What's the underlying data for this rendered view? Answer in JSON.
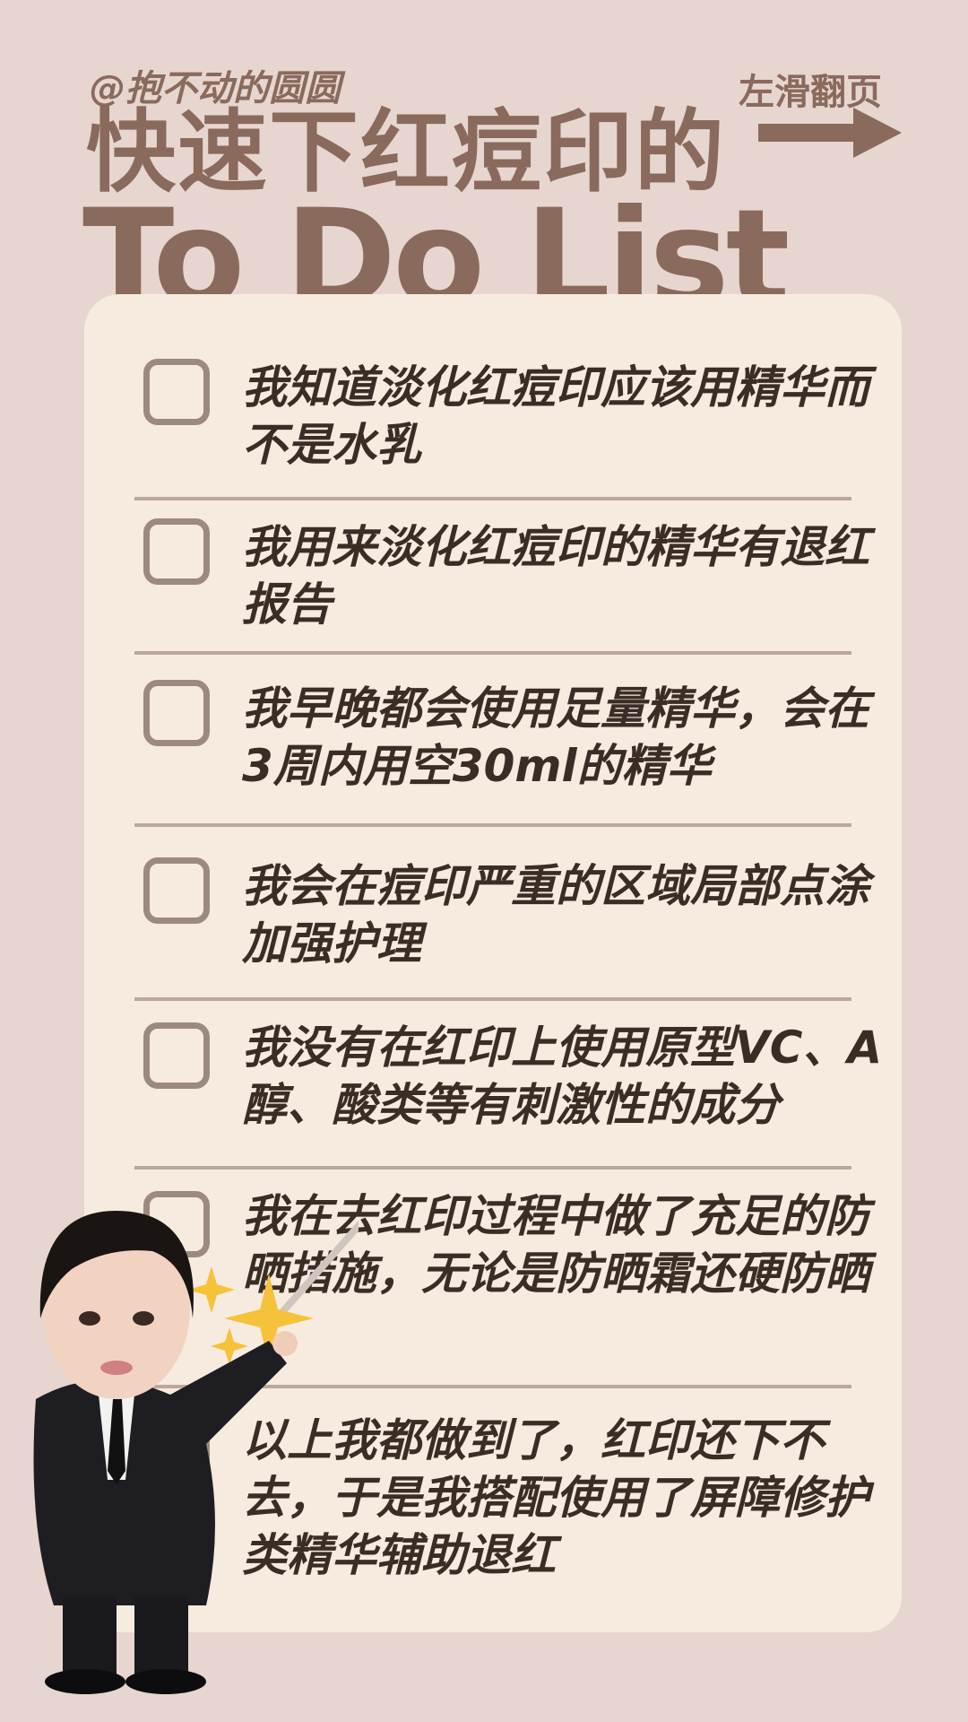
{
  "header": {
    "handle": "@抱不动的圆圆",
    "title_cn": "快速下红痘印的",
    "title_en": "To Do List",
    "swipe_hint": "左滑翻页"
  },
  "checklist": {
    "items": [
      {
        "text": "我知道淡化红痘印应该用精华而不是水乳",
        "checked": false
      },
      {
        "text": "我用来淡化红痘印的精华有退红报告",
        "checked": false
      },
      {
        "text": "我早晚都会使用足量精华，会在3周内用空30ml的精华",
        "checked": false
      },
      {
        "text": "我会在痘印严重的区域局部点涂加强护理",
        "checked": false
      },
      {
        "text": "我没有在红印上使用原型VC、A醇、酸类等有刺激性的成分",
        "checked": false
      },
      {
        "text": "我在去红印过程中做了充足的防晒措施，无论是防晒霜还硬防晒",
        "checked": false
      },
      {
        "text": "以上我都做到了，红印还下不去，于是我搭配使用了屏障修护类精华辅助退红",
        "checked": false
      }
    ]
  },
  "colors": {
    "background": "#e6d6cf",
    "card": "#f7ebe0",
    "accent": "#8a6a5c"
  }
}
